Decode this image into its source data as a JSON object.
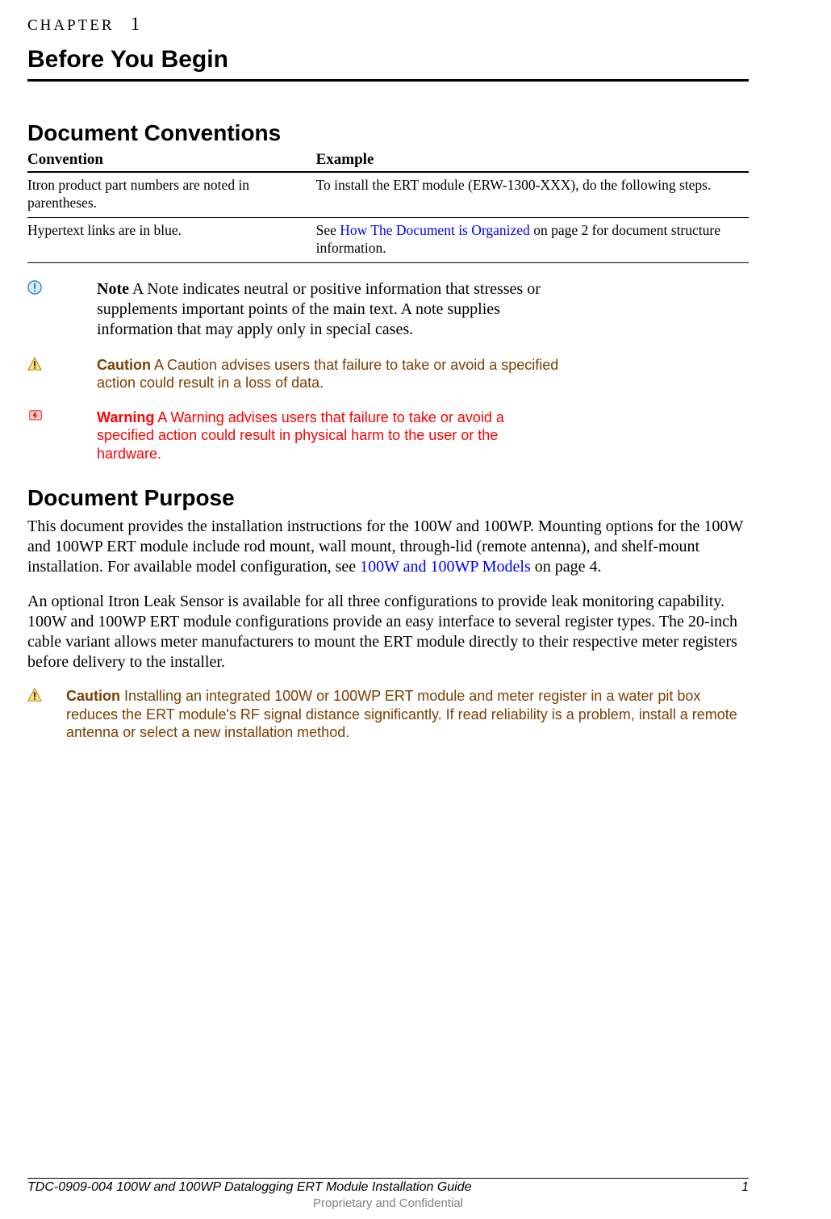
{
  "chapter": {
    "label": "CHAPTER",
    "number": "1",
    "title": "Before You Begin"
  },
  "doc_conventions": {
    "heading": "Document Conventions",
    "col1_header": "Convention",
    "col2_header": "Example",
    "rows": [
      {
        "conv": "Itron product part numbers are noted in parentheses.",
        "ex_before": "To install the ERT module (ERW-1300-XXX), do the following steps.",
        "ex_link": "",
        "ex_after": ""
      },
      {
        "conv": "Hypertext links are in blue.",
        "ex_before": "See ",
        "ex_link": "How The Document is Organized",
        "ex_after": " on page 2 for document structure information."
      }
    ],
    "note": {
      "label": "Note",
      "text": "  A Note indicates neutral or positive information that stresses or supplements important points of the main text. A note supplies information that may apply only in special cases."
    },
    "caution": {
      "label": "Caution",
      "text": "  A Caution advises users that failure to take or avoid a specified action could result in a loss of data."
    },
    "warning": {
      "label": "Warning",
      "text": "  A Warning advises users that failure to take or avoid a specified action could result in physical harm to the user or the hardware."
    }
  },
  "doc_purpose": {
    "heading": "Document Purpose",
    "p1_before": "This document provides the installation instructions for the 100W and 100WP. Mounting options for the 100W and 100WP ERT module include rod mount, wall mount, through-lid (remote antenna), and shelf-mount installation. For available model configuration, see ",
    "p1_link": "100W and 100WP Models",
    "p1_after": " on page 4.",
    "p2": "An optional Itron Leak Sensor is available for all three configurations to provide leak monitoring capability. 100W and 100WP ERT module configurations provide an easy interface to several register types. The 20-inch cable variant allows meter manufacturers to mount the ERT module directly to their respective meter registers before delivery to the installer.",
    "caution": {
      "label": "Caution",
      "text": "  Installing an integrated 100W or 100WP ERT module and meter register in a water pit box reduces the ERT module's RF signal distance significantly. If read reliability is a problem, install a remote antenna or select a new installation method."
    }
  },
  "footer": {
    "left": "TDC-0909-004 100W and 100WP Datalogging ERT Module Installation Guide",
    "right": "1",
    "center": "Proprietary and Confidential"
  }
}
